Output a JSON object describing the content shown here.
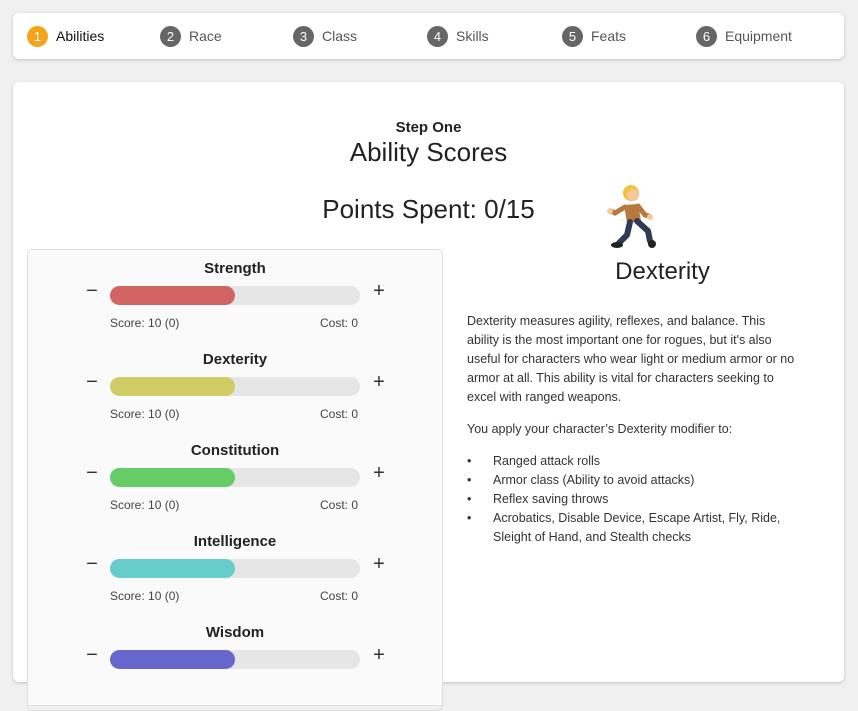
{
  "steps": [
    {
      "num": "1",
      "label": "Abilities"
    },
    {
      "num": "2",
      "label": "Race"
    },
    {
      "num": "3",
      "label": "Class"
    },
    {
      "num": "4",
      "label": "Skills"
    },
    {
      "num": "5",
      "label": "Feats"
    },
    {
      "num": "6",
      "label": "Equipment"
    }
  ],
  "active_step": "Abilities",
  "header": {
    "step_label": "Step One",
    "title": "Ability Scores",
    "points_spent": "Points Spent: 0/15"
  },
  "abilities": [
    {
      "name": "Strength",
      "minus": "−",
      "plus": "+",
      "score": "Score: 10 (0)",
      "cost": "Cost: 0",
      "color": "#d26464",
      "level": 0.5
    },
    {
      "name": "Dexterity",
      "minus": "−",
      "plus": "+",
      "score": "Score: 10 (0)",
      "cost": "Cost: 0",
      "color": "#d0cd66",
      "level": 0.5
    },
    {
      "name": "Constitution",
      "minus": "−",
      "plus": "+",
      "score": "Score: 10 (0)",
      "cost": "Cost: 0",
      "color": "#66cc66",
      "level": 0.5
    },
    {
      "name": "Intelligence",
      "minus": "−",
      "plus": "+",
      "score": "Score: 10 (0)",
      "cost": "Cost: 0",
      "color": "#66cccc",
      "level": 0.5
    },
    {
      "name": "Wisdom",
      "minus": "−",
      "plus": "+",
      "score": "",
      "cost": "",
      "color": "#6666cc",
      "level": 0.5
    }
  ],
  "detail": {
    "icon": "person-running-icon",
    "title": "Dexterity",
    "description": "Dexterity measures agility, reflexes, and balance. This ability is the most important one for rogues, but it's also useful for characters who wear light or medium armor or no armor at all. This ability is vital for characters seeking to excel with ranged weapons.",
    "apply_text": "You apply your character’s Dexterity modifier to:",
    "applies": [
      "Ranged attack rolls",
      "Armor class (Ability to avoid attacks)",
      "Reflex saving throws",
      "Acrobatics, Disable Device, Escape Artist, Fly, Ride, Sleight of Hand, and Stealth checks"
    ]
  }
}
